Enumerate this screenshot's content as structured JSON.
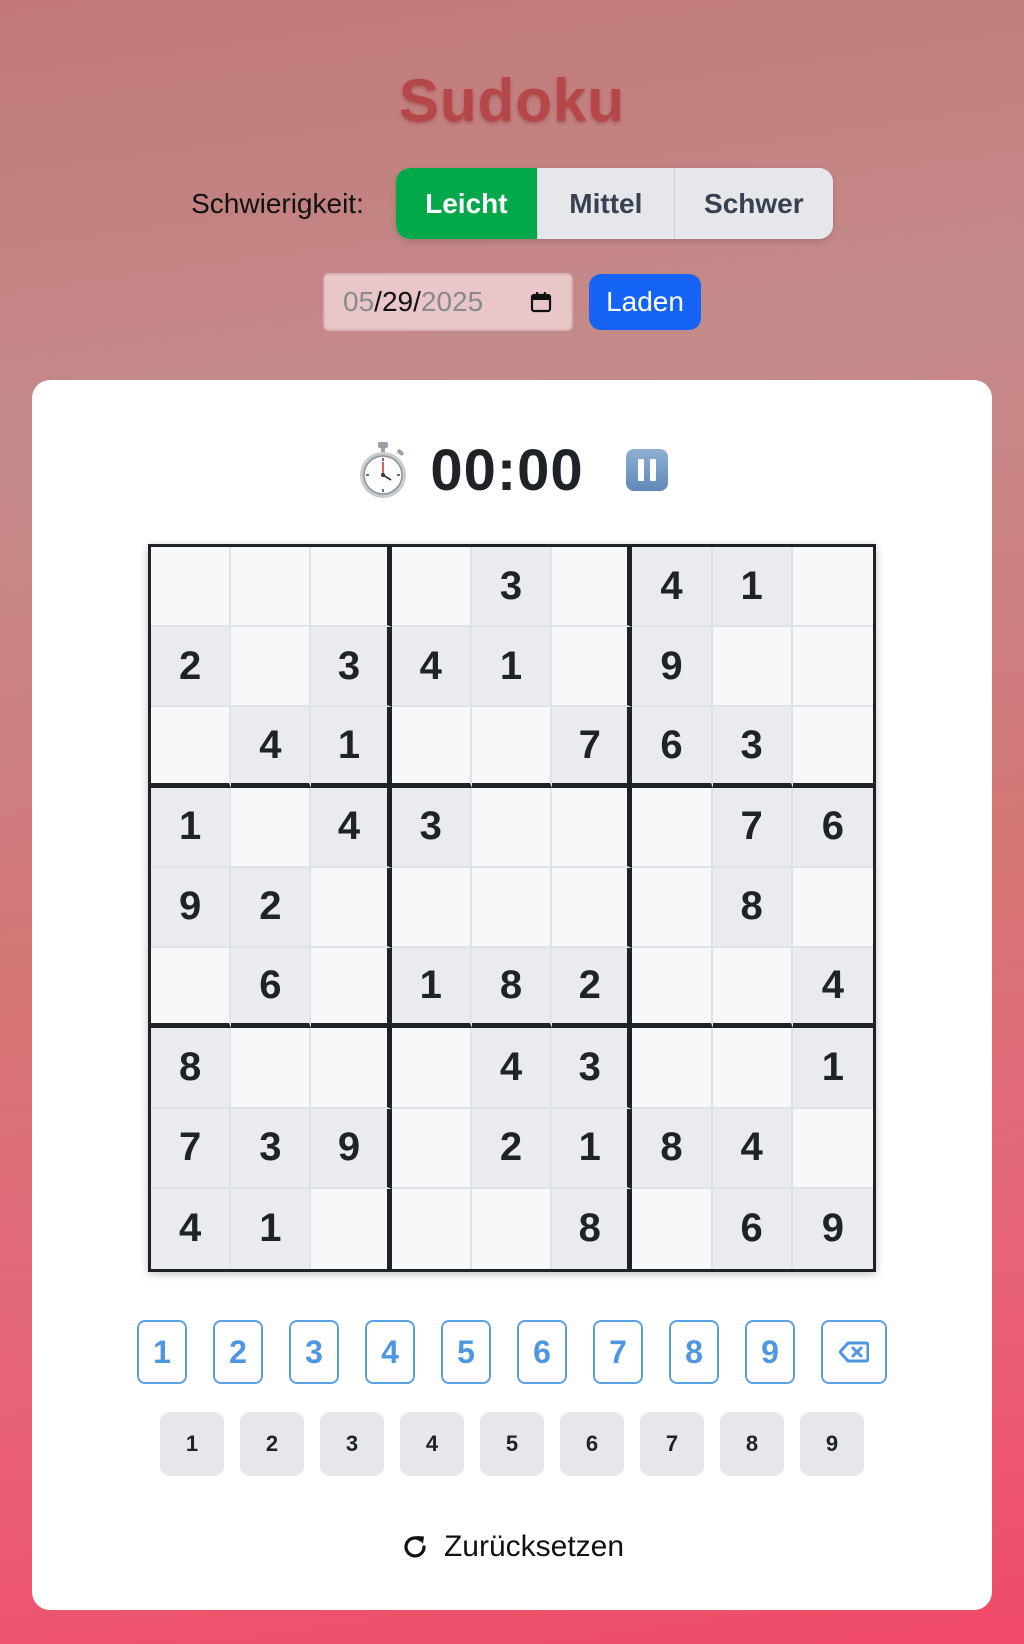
{
  "app": {
    "title": "Sudoku"
  },
  "difficulty": {
    "label": "Schwierigkeit:",
    "options": [
      "Leicht",
      "Mittel",
      "Schwer"
    ],
    "selected": "Leicht"
  },
  "date_picker": {
    "month": "05",
    "day": "29",
    "year": "2025",
    "icon": "calendar-icon"
  },
  "load_button": {
    "label": "Laden"
  },
  "timer": {
    "icon": "stopwatch-icon",
    "value": "00:00",
    "pause_icon": "pause-icon"
  },
  "board": [
    [
      "",
      "",
      "",
      "",
      "3",
      "",
      "4",
      "1",
      ""
    ],
    [
      "2",
      "",
      "3",
      "4",
      "1",
      "",
      "9",
      "",
      ""
    ],
    [
      "",
      "4",
      "1",
      "",
      "",
      "7",
      "6",
      "3",
      ""
    ],
    [
      "1",
      "",
      "4",
      "3",
      "",
      "",
      "",
      "7",
      "6"
    ],
    [
      "9",
      "2",
      "",
      "",
      "",
      "",
      "",
      "8",
      ""
    ],
    [
      "",
      "6",
      "",
      "1",
      "8",
      "2",
      "",
      "",
      "4"
    ],
    [
      "8",
      "",
      "",
      "",
      "4",
      "3",
      "",
      "",
      "1"
    ],
    [
      "7",
      "3",
      "9",
      "",
      "2",
      "1",
      "8",
      "4",
      ""
    ],
    [
      "4",
      "1",
      "",
      "",
      "",
      "8",
      "",
      "6",
      "9"
    ]
  ],
  "numpad": {
    "digits": [
      "1",
      "2",
      "3",
      "4",
      "5",
      "6",
      "7",
      "8",
      "9"
    ],
    "erase_icon": "backspace-icon"
  },
  "notes_pad": {
    "digits": [
      "1",
      "2",
      "3",
      "4",
      "5",
      "6",
      "7",
      "8",
      "9"
    ]
  },
  "reset": {
    "label": "Zurücksetzen",
    "icon": "refresh-icon"
  },
  "colors": {
    "selected_difficulty": "#03a84a",
    "load_button": "#1564f5",
    "numpad_accent": "#4f96e0"
  }
}
